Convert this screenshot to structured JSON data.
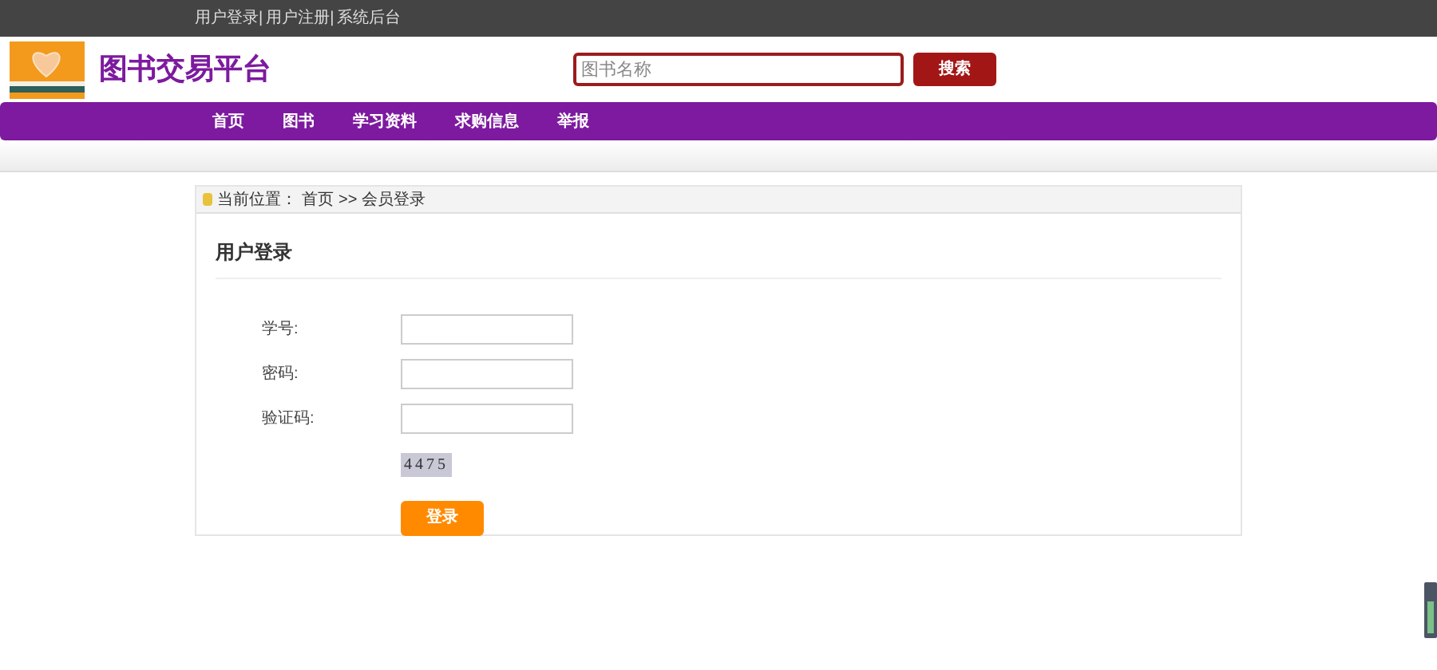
{
  "top_links": [
    "用户登录|",
    "用户注册|",
    "系统后台"
  ],
  "header": {
    "title": "图书交易平台",
    "search": {
      "placeholder": "图书名称"
    },
    "search_button": "搜索"
  },
  "nav": [
    "首页",
    "图书",
    "学习资料",
    "求购信息",
    "举报"
  ],
  "breadcrumb": {
    "label": "当前位置：",
    "items": [
      "首页",
      ">>",
      "会员登录"
    ]
  },
  "login": {
    "title": "用户登录",
    "fields": [
      {
        "label": "学号:"
      },
      {
        "label": "密码:"
      },
      {
        "label": "验证码:"
      }
    ],
    "captcha": "4475",
    "submit": "登录"
  }
}
